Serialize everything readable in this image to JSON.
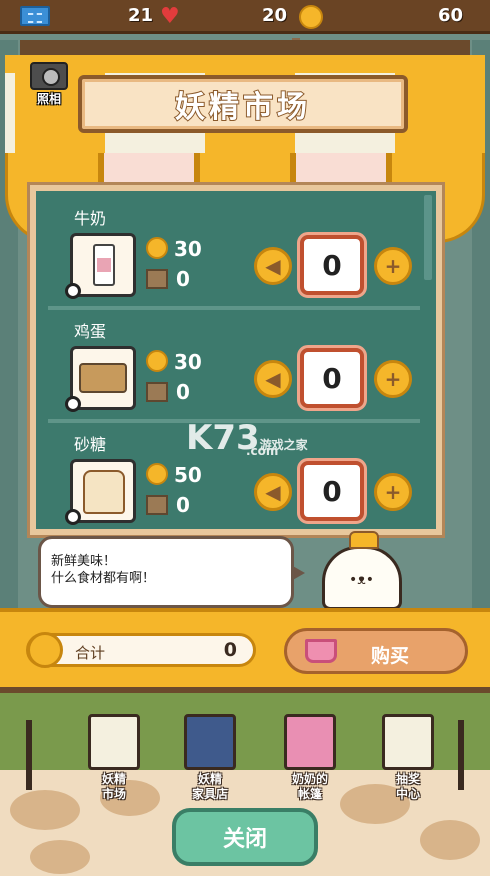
{
  "topbar": {
    "tickets": "21",
    "hearts": "20",
    "coins": "60"
  },
  "camera": {
    "label": "照相"
  },
  "market_title": "妖精市场",
  "items": [
    {
      "name": "牛奶",
      "price": "30",
      "stock": "0",
      "quantity": "0",
      "icon": "milk-bottle-icon"
    },
    {
      "name": "鸡蛋",
      "price": "30",
      "stock": "0",
      "quantity": "0",
      "icon": "egg-tray-icon"
    },
    {
      "name": "砂糖",
      "price": "50",
      "stock": "0",
      "quantity": "0",
      "icon": "sugar-bag-icon"
    }
  ],
  "speech": {
    "line1": "新鲜美味！",
    "line2": "什么食材都有啊！"
  },
  "total": {
    "label": "合计",
    "value": "0"
  },
  "buy_label": "购买",
  "nav": [
    {
      "label": "妖精\n市场"
    },
    {
      "label": "妖精\n家具店"
    },
    {
      "label": "奶奶的\n帐篷"
    },
    {
      "label": "抽奖\n中心"
    }
  ],
  "close_label": "关闭",
  "watermark": {
    "main": "K73",
    "sub": "游戏之家",
    "sub2": ".com"
  },
  "colors": {
    "accent_yellow": "#f5b62a",
    "board_green": "#3d7a6d",
    "quantity_border": "#c0502f",
    "close_button": "#6cc4a2",
    "buy_button": "#e8a26a"
  }
}
